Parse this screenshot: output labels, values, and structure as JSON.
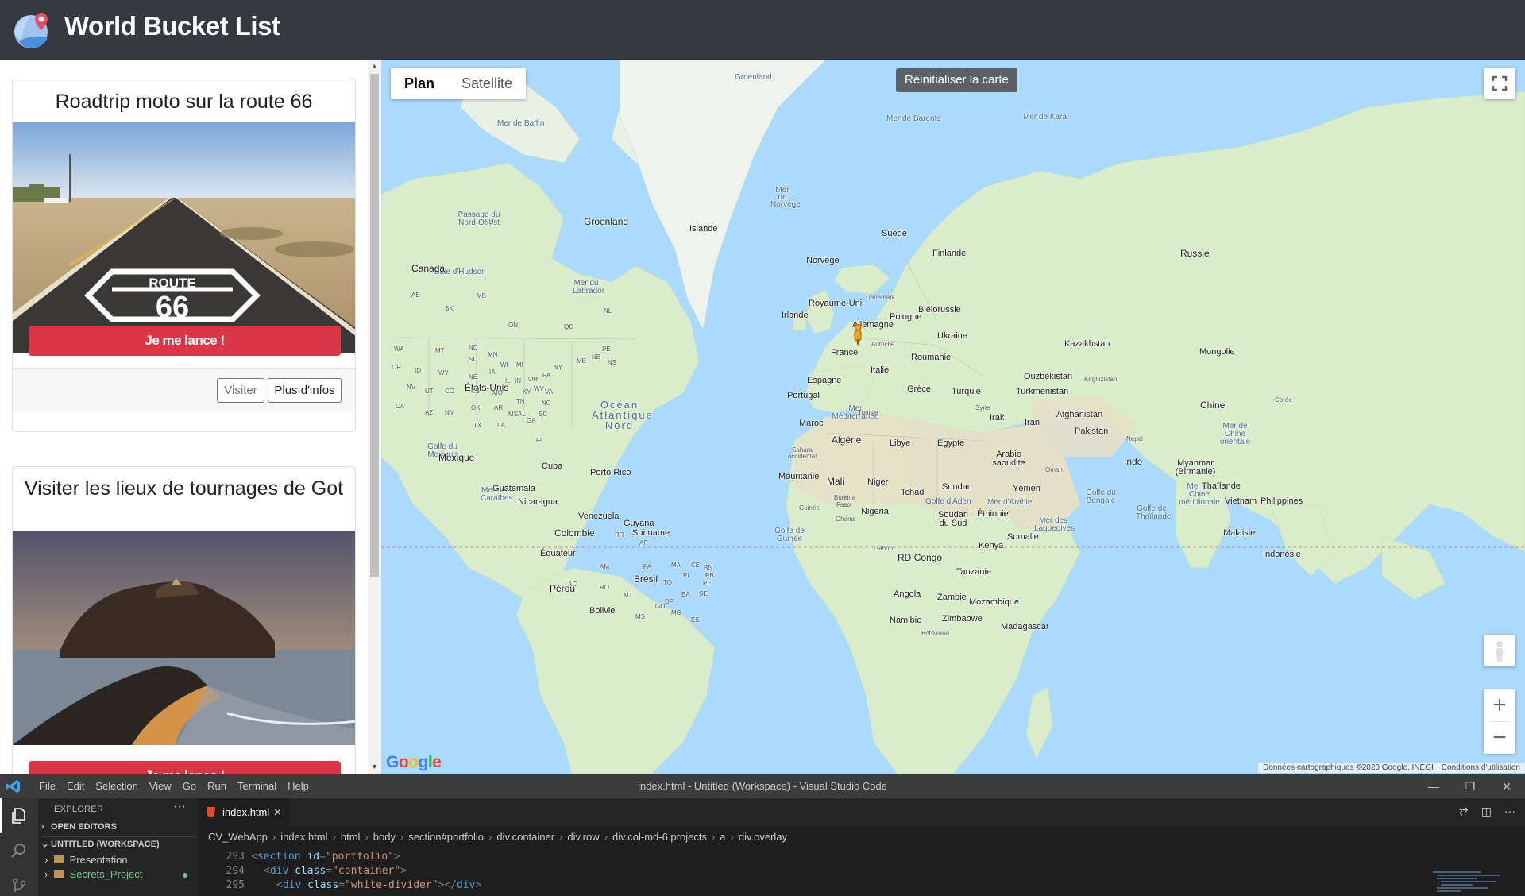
{
  "app": {
    "title": "World Bucket List"
  },
  "cards": [
    {
      "title": "Roadtrip moto sur la route 66",
      "image_alt": "route-66-road-photo",
      "cta_label": "Je me lance !",
      "visit_label": "Visiter",
      "info_label": "Plus d'infos"
    },
    {
      "title": "Visiter les lieux de tournages de Got",
      "image_alt": "coastal-rock-island-photo",
      "cta_label": "Je me lance !"
    }
  ],
  "map": {
    "type_options": [
      "Plan",
      "Satellite"
    ],
    "selected_type": "Plan",
    "reset_label": "Réinitialiser la carte",
    "attribution": "Données cartographiques ©2020 Google, INEGI",
    "terms": "Conditions d'utilisation",
    "google_logo": "Google",
    "labels": {
      "groenland": "Groenland",
      "groenland_top": "Groenland",
      "islande": "Islande",
      "canada": "Canada",
      "etats_unis": "États-Unis",
      "mexique": "Mexique",
      "cuba": "Cuba",
      "porto_rico": "Porto Rico",
      "guatemala": "Guatemala",
      "nicaragua": "Nicaragua",
      "venezuela": "Venezuela",
      "guyana": "Guyana",
      "suriname": "Suriname",
      "colombie": "Colombie",
      "equateur": "Équateur",
      "perou": "Pérou",
      "bresil": "Brésil",
      "bolivie": "Bolivie",
      "suede": "Suède",
      "norvege": "Norvège",
      "finlande": "Finlande",
      "russie": "Russie",
      "danemark": "Danemark",
      "royaume_uni": "Royaume-Uni",
      "irlande": "Irlande",
      "bielorussie": "Biélorussie",
      "pologne": "Pologne",
      "allemagne": "Allemagne",
      "ukraine": "Ukraine",
      "autriche": "Autriche",
      "france": "France",
      "kazakhstan": "Kazakhstan",
      "mongolie": "Mongolie",
      "roumanie": "Roumanie",
      "italie": "Italie",
      "espagne": "Espagne",
      "portugal": "Portugal",
      "grece": "Grèce",
      "turquie": "Turquie",
      "ouzbekistan": "Ouzbékistan",
      "kirghizistan": "Kirghizistan",
      "turkmenistan": "Turkménistan",
      "syrie": "Syrie",
      "tunisie": "Tunisie",
      "afghanistan": "Afghanistan",
      "chine": "Chine",
      "iran": "Iran",
      "irak": "Irak",
      "maroc": "Maroc",
      "algerie": "Algérie",
      "libye": "Libye",
      "egypte": "Égypte",
      "pakistan": "Pakistan",
      "nepal": "Népal",
      "arabie_saoudite": "Arabie saoudite",
      "sahara": "Sahara occidental",
      "oman": "Oman",
      "inde": "Inde",
      "myanmar": "Myanmar (Birmanie)",
      "mauritanie": "Mauritanie",
      "mali": "Mali",
      "niger": "Niger",
      "tchad": "Tchad",
      "soudan": "Soudan",
      "yemen": "Yémen",
      "thailande": "Thaïlande",
      "vietnam": "Vietnam",
      "philippines": "Philippines",
      "burkina": "Burkina Faso",
      "guinee": "Guinée",
      "nigeria": "Nigeria",
      "ghana": "Ghana",
      "ethiopie": "Éthiopie",
      "soudan_sud": "Soudan du Sud",
      "somalie": "Somalie",
      "malaisie": "Malaisie",
      "gabon": "Gabon",
      "kenya": "Kenya",
      "rd_congo": "RD Congo",
      "indonesie": "Indonésie",
      "tanzanie": "Tanzanie",
      "angola": "Angola",
      "zambie": "Zambie",
      "mozambique": "Mozambique",
      "namibie": "Namibie",
      "zimbabwe": "Zimbabwe",
      "madagascar": "Madagascar",
      "botswana": "Botswana",
      "coree": "Corée",
      "chine_orientale": "Mer de Chine orientale",
      "mer_baffin": "Mer de Baffin",
      "mer_barents": "Mer de Barents",
      "mer_kara": "Mer de Kara",
      "mer_norvege": "Mer de Norvège",
      "passage_nord_ouest": "Passage du Nord-Ouest",
      "baie_hudson": "Baie d'Hudson",
      "mer_labrador": "Mer du Labrador",
      "ocean_atlantique": "Océan Atlantique Nord",
      "golfe_mexique": "Golfe du Mexique",
      "mer_caraibes": "Mer des Caraïbes",
      "mer_mediterranee": "Mer Méditerranée",
      "golfe_aden": "Golfe d'Aden",
      "mer_arabie": "Mer d'Arabie",
      "golfe_bengale": "Golfe du Bengale",
      "golfe_thailande": "Golfe de Thaïlande",
      "mer_chine_meridionale": "Mer de Chine méridionale",
      "mer_laquedives": "Mer des Laquedives",
      "golfe_guinee": "Golfe de Guinée",
      "nu": "NU",
      "ab": "AB",
      "sk": "SK",
      "mb": "MB",
      "on": "ON",
      "qc": "QC",
      "nl": "NL",
      "wa": "WA",
      "mt": "MT",
      "nd": "ND",
      "mn": "MN",
      "or": "OR",
      "id": "ID",
      "wy": "WY",
      "sd": "SD",
      "nv": "NV",
      "ut": "UT",
      "co": "CO",
      "ne": "NE",
      "ia": "IA",
      "ca": "CA",
      "az": "AZ",
      "nm": "NM",
      "ok": "OK",
      "tx": "TX",
      "ks": "KS",
      "mo": "MO",
      "ar": "AR",
      "la": "LA",
      "ms": "MS",
      "al": "AL",
      "ga": "GA",
      "fl": "FL",
      "tn": "TN",
      "ky": "KY",
      "in": "IN",
      "oh": "OH",
      "wi": "WI",
      "mi": "MI",
      "il": "IL",
      "pa": "PA",
      "ny": "NY",
      "nc": "NC",
      "sc": "SC",
      "va": "VA",
      "wv": "WV",
      "me": "ME",
      "nb": "NB",
      "ns": "NS",
      "pe": "PE",
      "am": "AM",
      "pa_br": "PA",
      "ma": "MA",
      "ce": "CE",
      "rn": "RN",
      "pb": "PB",
      "pe_br": "PE",
      "ac": "AC",
      "ro": "RO",
      "to": "TO",
      "pi": "PI",
      "ba": "BA",
      "se": "SE",
      "mt_br": "MT",
      "go": "GO",
      "df": "DF",
      "mg": "MG",
      "ms_br": "MS",
      "es": "ES",
      "rr": "RR",
      "ap": "AP"
    },
    "marker": "orange-pegman-marker"
  },
  "vscode": {
    "menu": [
      "File",
      "Edit",
      "Selection",
      "View",
      "Go",
      "Run",
      "Terminal",
      "Help"
    ],
    "title": "index.html - Untitled (Workspace) - Visual Studio Code",
    "explorer_label": "EXPLORER",
    "open_editors": "OPEN EDITORS",
    "workspace": "UNTITLED (WORKSPACE)",
    "tree": [
      "Presentation",
      "Secrets_Project"
    ],
    "tab": "index.html",
    "breadcrumb": [
      "CV_WebApp",
      "index.html",
      "html",
      "body",
      "section#portfolio",
      "div.container",
      "div.row",
      "div.col-md-6.projects",
      "a",
      "div.overlay"
    ],
    "lines": [
      {
        "num": "293",
        "code_tag": "section",
        "code_attr": "id",
        "code_val": "\"portfolio\""
      },
      {
        "num": "294",
        "code_tag": "div",
        "code_attr": "class",
        "code_val": "\"container\""
      },
      {
        "num": "295",
        "code_tag": "div",
        "code_attr": "class",
        "code_val": "\"white-divider\""
      }
    ]
  },
  "colors": {
    "header_bg": "#343a40",
    "cta_red": "#dc3545",
    "water": "#aadaff",
    "land": "#d8eec9",
    "vscode_bg": "#1e1e1e"
  }
}
